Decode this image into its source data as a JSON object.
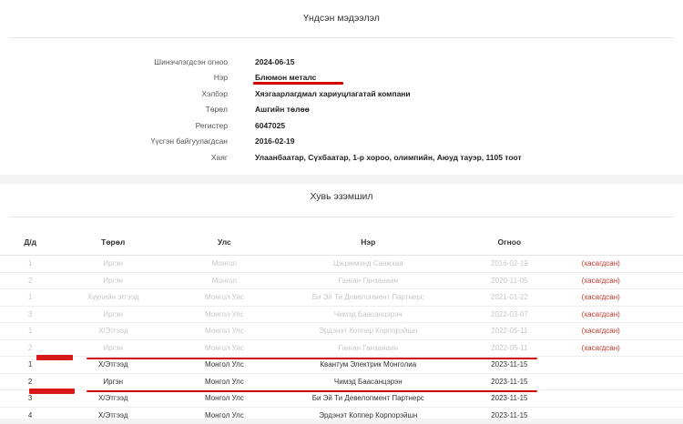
{
  "main_info": {
    "title": "Үндсэн мэдээлэл",
    "rows": [
      {
        "label": "Шинэчлэгдсэн огноо",
        "value": "2024-06-15"
      },
      {
        "label": "Нэр",
        "value": "Блюмон металс"
      },
      {
        "label": "Хэлбэр",
        "value": "Хязгаарлагдмал хариуцлагатай компани"
      },
      {
        "label": "Төрөл",
        "value": "Ашгийн төлөө"
      },
      {
        "label": "Регистер",
        "value": "6047025"
      },
      {
        "label": "Үүсгэн байгуулагдсан",
        "value": "2016-02-19"
      },
      {
        "label": "Хаяг",
        "value": "Улаанбаатар, Сүхбаатар, 1-р хороо, олимпийн, Аюуд тауэр, 1105 тоот"
      }
    ]
  },
  "shares": {
    "title": "Хувь эзэмшил",
    "columns": {
      "idx": "Д/д",
      "type": "Төрөл",
      "country": "Улс",
      "name": "Нэр",
      "date": "Огноо"
    },
    "rows": [
      {
        "idx": "1",
        "type": "Иргэн",
        "country": "Монгол",
        "name": "Цэцэнмэнд Санжхаа",
        "date": "2016-02-19",
        "status": "(хасагдсан)",
        "dim": true
      },
      {
        "idx": "2",
        "type": "Иргэн",
        "country": "Монгол",
        "name": "Ганган Ганзанаин",
        "date": "2020-11-05",
        "status": "(хасагдсан)",
        "dim": true
      },
      {
        "idx": "1",
        "type": "Хуулийн этгээд",
        "country": "Монгол Улс",
        "name": "Би Эй Ти Девелопмент Партнерс",
        "date": "2021-01-22",
        "status": "(хасагдсан)",
        "dim": true
      },
      {
        "idx": "3",
        "type": "Иргэн",
        "country": "Монгол Улс",
        "name": "Чимэд Баасанцэрэн",
        "date": "2022-03-07",
        "status": "(хасагдсан)",
        "dim": true
      },
      {
        "idx": "1",
        "type": "Х/Этгээд",
        "country": "Монгол Улс",
        "name": "Эрдэнэт Коппер Корпорэйшн",
        "date": "2022-05-11",
        "status": "(хасагдсан)",
        "dim": true
      },
      {
        "idx": "2",
        "type": "Иргэн",
        "country": "Монгол Улс",
        "name": "Ганган Ганзанаин",
        "date": "2022-05-11",
        "status": "(хасагдсан)",
        "dim": true
      },
      {
        "idx": "1",
        "type": "Х/Этгээд",
        "country": "Монгол Улс",
        "name": "Квантум Электрик Монголиа",
        "date": "2023-11-15",
        "status": "",
        "dim": false
      },
      {
        "idx": "2",
        "type": "Иргэн",
        "country": "Монгол Улс",
        "name": "Чимэд Баасанцэрэн",
        "date": "2023-11-15",
        "status": "",
        "dim": false
      },
      {
        "idx": "3",
        "type": "Х/Этгээд",
        "country": "Монгол Улс",
        "name": "Би Эй Ти Девелопмент Партнерс",
        "date": "2023-11-15",
        "status": "",
        "dim": false
      },
      {
        "idx": "4",
        "type": "Х/Этгээд",
        "country": "Монгол Улс",
        "name": "Эрдэнэт Коппер Корпорэйшн",
        "date": "2023-11-15",
        "status": "",
        "dim": false
      }
    ]
  },
  "colors": {
    "accent_red": "#d40000",
    "status_red": "#c0392b",
    "dim_text": "#c7c7c7"
  }
}
